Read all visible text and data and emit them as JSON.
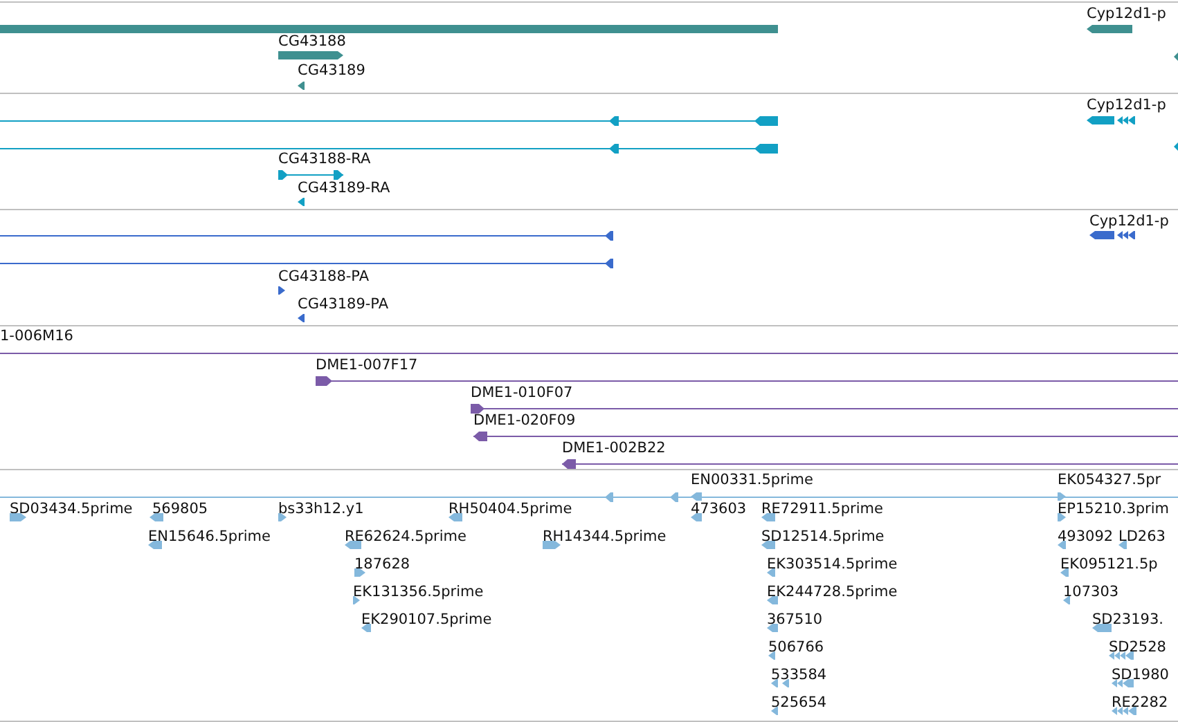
{
  "tracks": [
    {
      "color": "#3f9090",
      "features": [
        {
          "kind": "bar"
        },
        {
          "label": "CG43188",
          "kind": "bar",
          "reverse": false
        },
        {
          "label": "CG43189",
          "kind": "bar",
          "reverse": true
        },
        {
          "label": "Cyp12d1-p",
          "kind": "bar",
          "reverse": true
        },
        {
          "kind": "bar",
          "reverse": true
        }
      ]
    },
    {
      "color": "#12a0c4",
      "features": [
        {
          "kind": "transcript",
          "reverse": true
        },
        {
          "kind": "transcript",
          "reverse": true
        },
        {
          "label": "CG43188-RA",
          "kind": "transcript",
          "reverse": false
        },
        {
          "label": "CG43189-RA",
          "kind": "bar",
          "reverse": true
        },
        {
          "label": "Cyp12d1-p",
          "kind": "bar",
          "reverse": true
        },
        {
          "kind": "bar",
          "reverse": true
        }
      ]
    },
    {
      "color": "#3a6bcc",
      "features": [
        {
          "kind": "transcript",
          "reverse": true
        },
        {
          "kind": "transcript",
          "reverse": true
        },
        {
          "label": "CG43188-PA",
          "kind": "bar",
          "reverse": false
        },
        {
          "label": "CG43189-PA",
          "kind": "bar",
          "reverse": true
        },
        {
          "label": "Cyp12d1-p",
          "kind": "bar",
          "reverse": true
        }
      ]
    },
    {
      "color": "#7b5ba8",
      "features": [
        {
          "label": "1-006M16",
          "kind": "line"
        },
        {
          "label": "DME1-007F17",
          "kind": "transcript",
          "reverse": false
        },
        {
          "label": "DME1-010F07",
          "kind": "transcript",
          "reverse": false
        },
        {
          "label": "DME1-020F09",
          "kind": "transcript",
          "reverse": true
        },
        {
          "label": "DME1-002B22",
          "kind": "transcript",
          "reverse": true
        }
      ]
    },
    {
      "color": "#84b8dc",
      "features": [
        {
          "kind": "line"
        },
        {
          "label": "EN00331.5prime",
          "kind": "bar",
          "reverse": true
        },
        {
          "kind": "transcript",
          "reverse": true
        },
        {
          "label": "EK054327.5pr",
          "kind": "bar",
          "reverse": false
        },
        {
          "label": "SD03434.5prime",
          "kind": "bar",
          "reverse": false
        },
        {
          "label": "569805",
          "kind": "bar",
          "reverse": true
        },
        {
          "label": "bs33h12.y1",
          "kind": "bar",
          "reverse": false
        },
        {
          "label": "RH50404.5prime",
          "kind": "bar",
          "reverse": true
        },
        {
          "label": "473603",
          "kind": "bar",
          "reverse": true
        },
        {
          "label": "RE72911.5prime",
          "kind": "bar",
          "reverse": true
        },
        {
          "label": "EP15210.3prim",
          "kind": "bar",
          "reverse": false
        },
        {
          "label": "EN15646.5prime",
          "kind": "bar",
          "reverse": true
        },
        {
          "label": "RE62624.5prime",
          "kind": "bar",
          "reverse": true
        },
        {
          "label": "RH14344.5prime",
          "kind": "bar",
          "reverse": false
        },
        {
          "label": "SD12514.5prime",
          "kind": "bar",
          "reverse": true
        },
        {
          "label": "493092",
          "kind": "bar",
          "reverse": true
        },
        {
          "label": "LD263",
          "kind": "bar",
          "reverse": true
        },
        {
          "label": "187628",
          "kind": "bar",
          "reverse": false
        },
        {
          "label": "EK303514.5prime",
          "kind": "bar",
          "reverse": true
        },
        {
          "label": "EK095121.5p",
          "kind": "bar",
          "reverse": true
        },
        {
          "label": "EK131356.5prime",
          "kind": "bar",
          "reverse": false
        },
        {
          "label": "EK244728.5prime",
          "kind": "bar",
          "reverse": true
        },
        {
          "label": "107303",
          "kind": "bar",
          "reverse": true
        },
        {
          "label": "EK290107.5prime",
          "kind": "bar",
          "reverse": true
        },
        {
          "label": "367510",
          "kind": "bar",
          "reverse": true
        },
        {
          "label": "SD23193.",
          "kind": "bar",
          "reverse": true
        },
        {
          "label": "506766",
          "kind": "bar",
          "reverse": true
        },
        {
          "label": "SD2528",
          "kind": "bar",
          "reverse": true
        },
        {
          "label": "533584",
          "kind": "bar",
          "reverse": true
        },
        {
          "label": "SD1980",
          "kind": "bar",
          "reverse": true
        },
        {
          "label": "525654",
          "kind": "bar",
          "reverse": true
        },
        {
          "label": "RE2282",
          "kind": "bar",
          "reverse": true
        }
      ]
    }
  ]
}
